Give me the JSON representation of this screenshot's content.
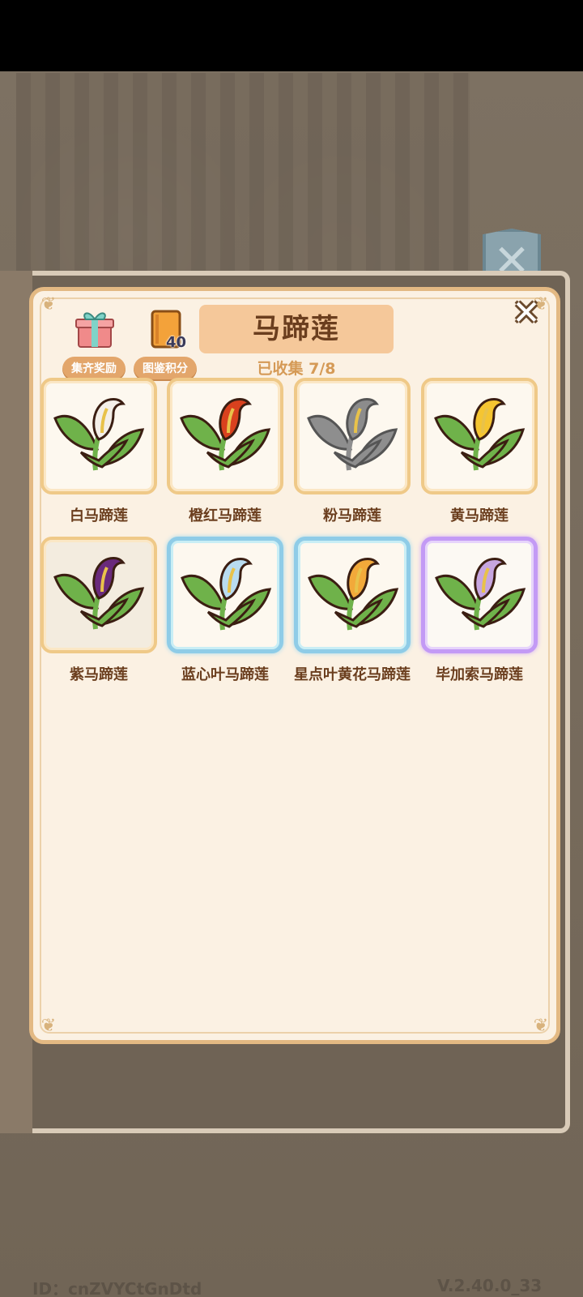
{
  "header": {
    "title": "马蹄莲",
    "progress": "已收集 7/8"
  },
  "buttons": {
    "gift_label": "集齐奖励",
    "score_label": "图鉴积分",
    "score_count": "40",
    "close_symbol": "✕"
  },
  "items": [
    {
      "name": "白马蹄莲",
      "spathe_color": "#f4efe8",
      "style": "normal"
    },
    {
      "name": "橙红马蹄莲",
      "spathe_color": "#d9411e",
      "style": "normal"
    },
    {
      "name": "粉马蹄莲",
      "spathe_color": "#8c8c8c",
      "style": "locked"
    },
    {
      "name": "黄马蹄莲",
      "spathe_color": "#f5c531",
      "style": "normal"
    },
    {
      "name": "紫马蹄莲",
      "spathe_color": "#6a2a7c",
      "style": "dim"
    },
    {
      "name": "蓝心叶马蹄莲",
      "spathe_color": "#b9dcf0",
      "style": "blue"
    },
    {
      "name": "星点叶黄花马蹄莲",
      "spathe_color": "#f2a93a",
      "style": "blue"
    },
    {
      "name": "毕加索马蹄莲",
      "spathe_color": "#c7a6e0",
      "style": "purple"
    }
  ],
  "footer": {
    "id_text": "ID：cnZVYCtGnDtd",
    "version": "V.2.40.0_33"
  }
}
